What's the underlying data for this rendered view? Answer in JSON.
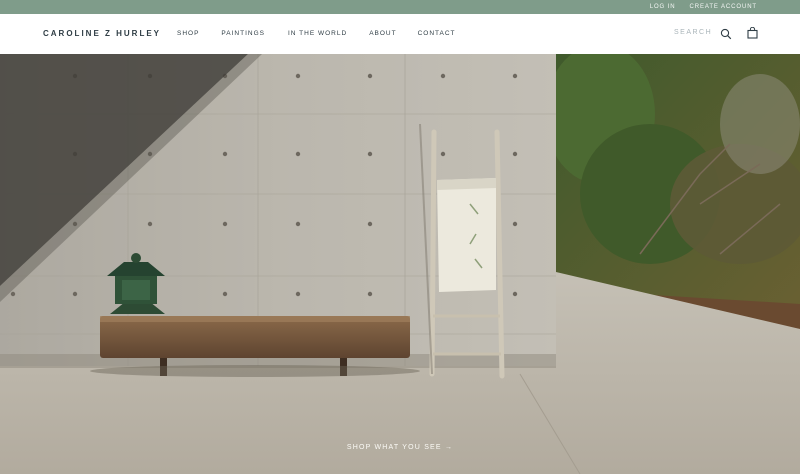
{
  "topbar": {
    "login": "LOG IN",
    "create_account": "CREATE ACCOUNT"
  },
  "header": {
    "logo": "CAROLINE Z HURLEY",
    "nav": [
      "SHOP",
      "PAINTINGS",
      "IN THE WORLD",
      "ABOUT",
      "CONTACT"
    ],
    "search_label": "SEARCH"
  },
  "hero": {
    "cta": "SHOP WHAT YOU SEE →"
  },
  "colors": {
    "topbar": "#7f9c8a",
    "nav_text": "#2f3d45",
    "search_text": "#a9b4b9",
    "cta_text": "#fbfaf6"
  },
  "icons": [
    "search-icon",
    "shopping-bag-icon"
  ]
}
